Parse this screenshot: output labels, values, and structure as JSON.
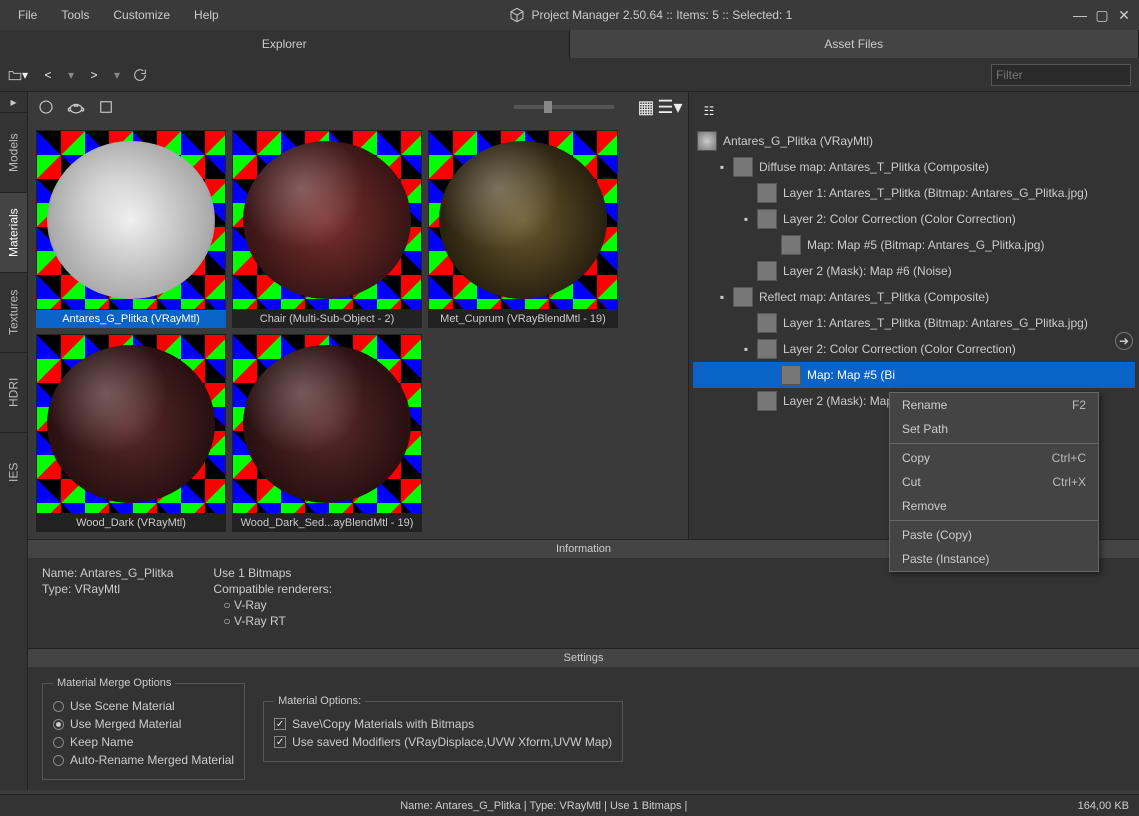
{
  "menu": {
    "file": "File",
    "tools": "Tools",
    "customize": "Customize",
    "help": "Help"
  },
  "title": "Project Manager 2.50.64  :: Items: 5  :: Selected: 1",
  "tabs": {
    "explorer": "Explorer",
    "asset_files": "Asset Files"
  },
  "filter": {
    "placeholder": "Filter"
  },
  "side": {
    "models": "Models",
    "materials": "Materials",
    "textures": "Textures",
    "hdri": "HDRI",
    "ies": "IES"
  },
  "thumbs": [
    {
      "label": "Antares_G_Plitka (VRayMtl)",
      "selected": true,
      "c1": "#eee",
      "c2": "#aaa"
    },
    {
      "label": "Chair (Multi-Sub-Object - 2)",
      "selected": false,
      "c1": "#7a3030",
      "c2": "#3a1515"
    },
    {
      "label": "Met_Cuprum (VRayBlendMtl - 19)",
      "selected": false,
      "c1": "#6b5a2e",
      "c2": "#2a2210"
    },
    {
      "label": "Wood_Dark (VRayMtl)",
      "selected": false,
      "c1": "#5a2a2a",
      "c2": "#2a1010"
    },
    {
      "label": "Wood_Dark_Sed...ayBlendMtl - 19)",
      "selected": false,
      "c1": "#5a2a2a",
      "c2": "#2a1010"
    }
  ],
  "tree": {
    "root": "Antares_G_Plitka (VRayMtl)",
    "n1": "Diffuse map: Antares_T_Plitka (Composite)",
    "n1a": "Layer 1: Antares_T_Plitka (Bitmap: Antares_G_Plitka.jpg)",
    "n1b": "Layer 2: Color Correction (Color Correction)",
    "n1b1": "Map: Map #5 (Bitmap: Antares_G_Plitka.jpg)",
    "n1c": "Layer 2 (Mask): Map #6 (Noise)",
    "n2": "Reflect map: Antares_T_Plitka (Composite)",
    "n2a": "Layer 1: Antares_T_Plitka (Bitmap: Antares_G_Plitka.jpg)",
    "n2b": "Layer 2: Color Correction (Color Correction)",
    "n2b1": "Map: Map #5 (Bi",
    "n2c": "Layer 2 (Mask): Map #"
  },
  "info": {
    "header": "Information",
    "name_lbl": "Name: Antares_G_Plitka",
    "type_lbl": "Type: VRayMtl",
    "bitmaps": "Use 1 Bitmaps",
    "compat": "Compatible renderers:",
    "r1": "○ V-Ray",
    "r2": "○ V-Ray RT"
  },
  "settings": {
    "header": "Settings",
    "merge_legend": "Material Merge Options",
    "m1": "Use Scene Material",
    "m2": "Use Merged Material",
    "m3": "Keep Name",
    "m4": "Auto-Rename Merged Material",
    "opt_legend": "Material Options:",
    "o1": "Save\\Copy Materials with Bitmaps",
    "o2": "Use saved Modifiers (VRayDisplace,UVW Xform,UVW Map)"
  },
  "ctx": {
    "rename": "Rename",
    "rename_sc": "F2",
    "setpath": "Set Path",
    "copy": "Copy",
    "copy_sc": "Ctrl+C",
    "cut": "Cut",
    "cut_sc": "Ctrl+X",
    "remove": "Remove",
    "paste_copy": "Paste (Copy)",
    "paste_inst": "Paste (Instance)"
  },
  "status": {
    "center": "Name: Antares_G_Plitka  | Type: VRayMtl  | Use 1 Bitmaps  |",
    "right": "164,00 KB"
  }
}
